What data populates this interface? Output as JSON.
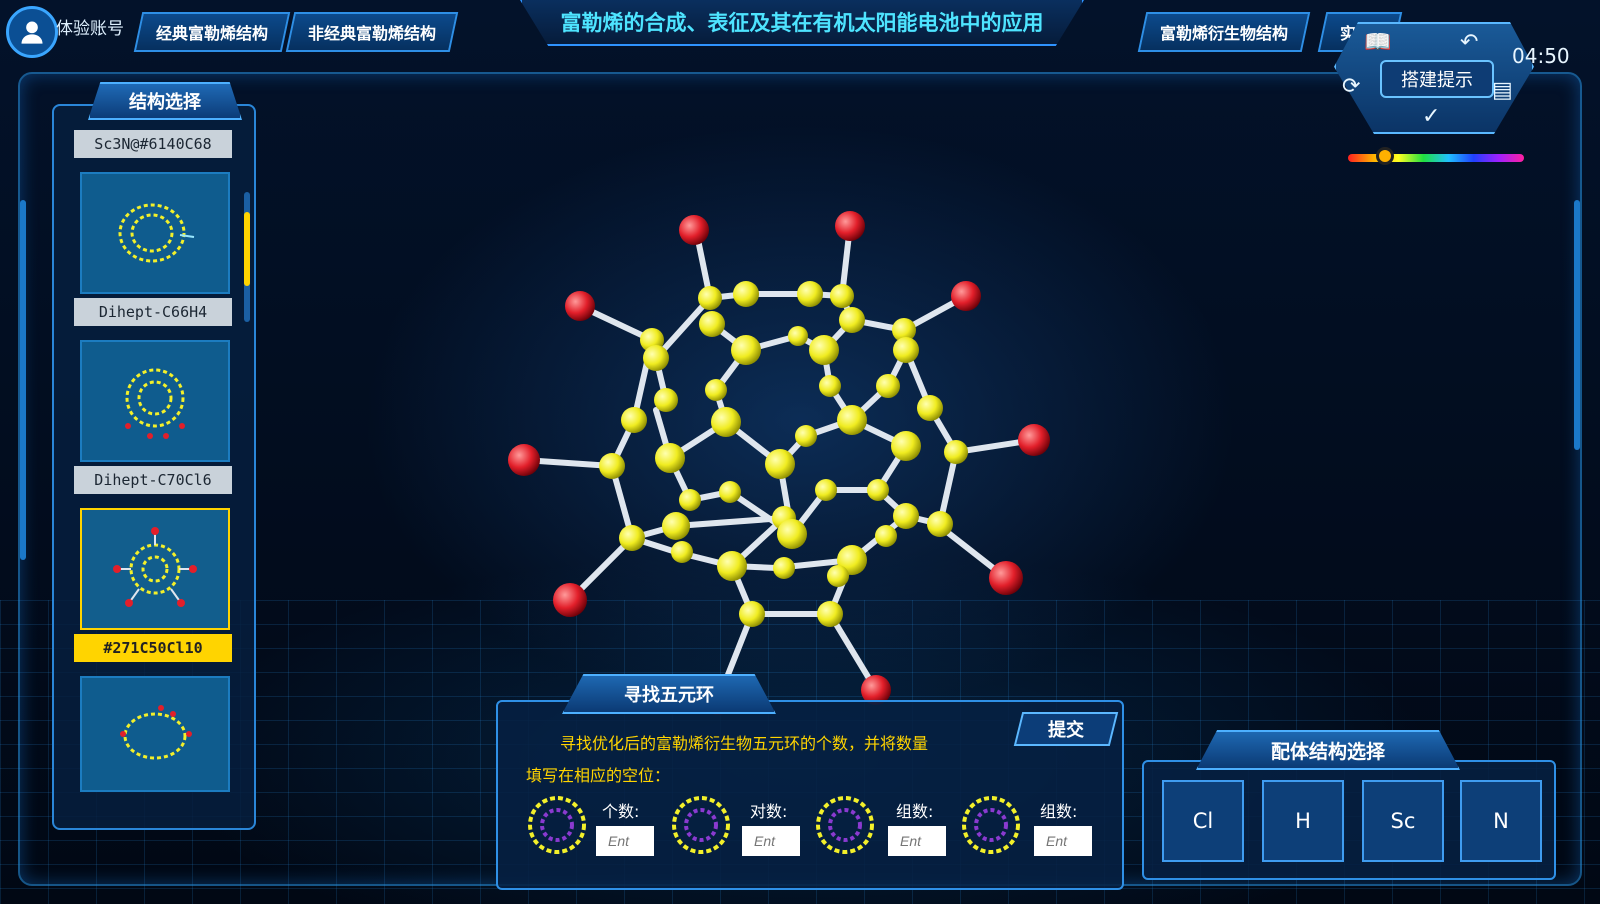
{
  "header": {
    "account": "体验账号",
    "tabs": [
      "经典富勒烯结构",
      "非经典富勒烯结构",
      "富勒烯衍生物结构",
      "实验"
    ],
    "title": "富勒烯的合成、表征及其在有机太阳能电池中的应用",
    "timer": "04:50"
  },
  "hint": {
    "label": "搭建提示"
  },
  "left_panel": {
    "title": "结构选择",
    "items": [
      {
        "label": "Sc3N@#6140C68"
      },
      {
        "label": "Dihept-C66H4"
      },
      {
        "label": "Dihept-C70Cl6"
      },
      {
        "label": "#271C50Cl10"
      }
    ],
    "selected": "#271C50Cl10"
  },
  "task": {
    "tab": "寻找五元环",
    "submit": "提交",
    "line1": "寻找优化后的富勒烯衍生物五元环的个数，并将数量",
    "line2": "填写在相应的空位：",
    "slots": [
      {
        "label": "个数:",
        "placeholder": "Ent"
      },
      {
        "label": "对数:",
        "placeholder": "Ent"
      },
      {
        "label": "组数:",
        "placeholder": "Ent"
      },
      {
        "label": "组数:",
        "placeholder": "Ent"
      }
    ]
  },
  "ligand": {
    "title": "配体结构选择",
    "options": [
      "Cl",
      "H",
      "Sc",
      "N"
    ]
  },
  "colors": {
    "accent": "#4ee4ff",
    "carbon": "#f3f02a",
    "chlorine": "#e21f2a",
    "selected": "#ffd400"
  }
}
